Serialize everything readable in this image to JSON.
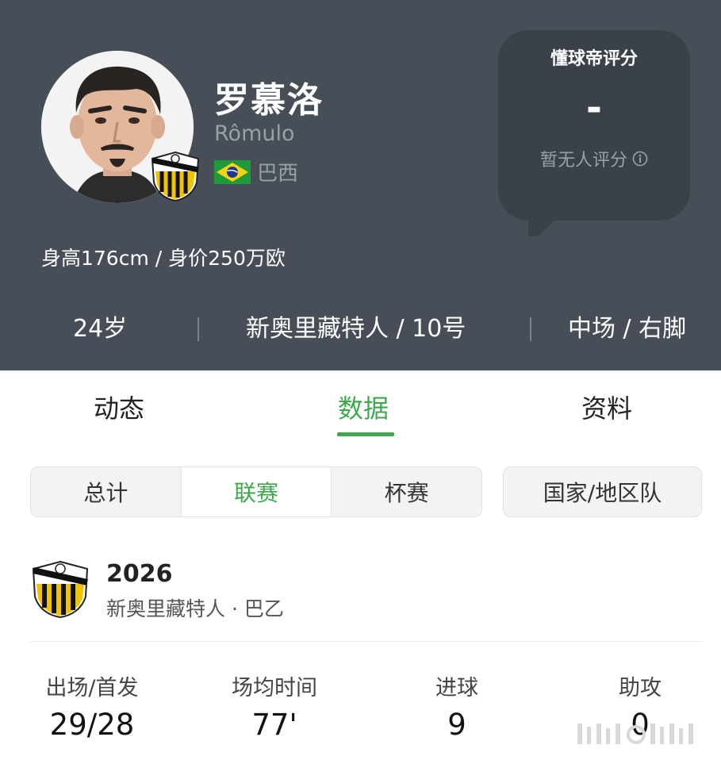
{
  "player": {
    "name_cn": "罗慕洛",
    "name_en": "Rômulo",
    "nation": "巴西",
    "body_info": "身高176cm / 身价250万欧"
  },
  "rating": {
    "title": "懂球帝评分",
    "value": "-",
    "note": "暂无人评分"
  },
  "meta": {
    "age": "24岁",
    "club_number": "新奥里藏特人 / 10号",
    "position_foot": "中场 / 右脚"
  },
  "tabs": [
    {
      "label": "动态"
    },
    {
      "label": "数据"
    },
    {
      "label": "资料"
    }
  ],
  "active_tab": "数据",
  "filters": {
    "segments": [
      {
        "label": "总计"
      },
      {
        "label": "联赛"
      },
      {
        "label": "杯赛"
      }
    ],
    "active_segment": "联赛",
    "national_team": "国家/地区队"
  },
  "season": {
    "year": "2026",
    "club_league": "新奥里藏特人 · 巴乙"
  },
  "stats": [
    {
      "label": "出场/首发",
      "value": "29/28"
    },
    {
      "label": "场均时间",
      "value": "77'"
    },
    {
      "label": "进球",
      "value": "9"
    },
    {
      "label": "助攻",
      "value": "0"
    }
  ],
  "colors": {
    "header_bg": "#474e57",
    "accent_green": "#3fa84e",
    "badge_yellow": "#f2c400"
  }
}
